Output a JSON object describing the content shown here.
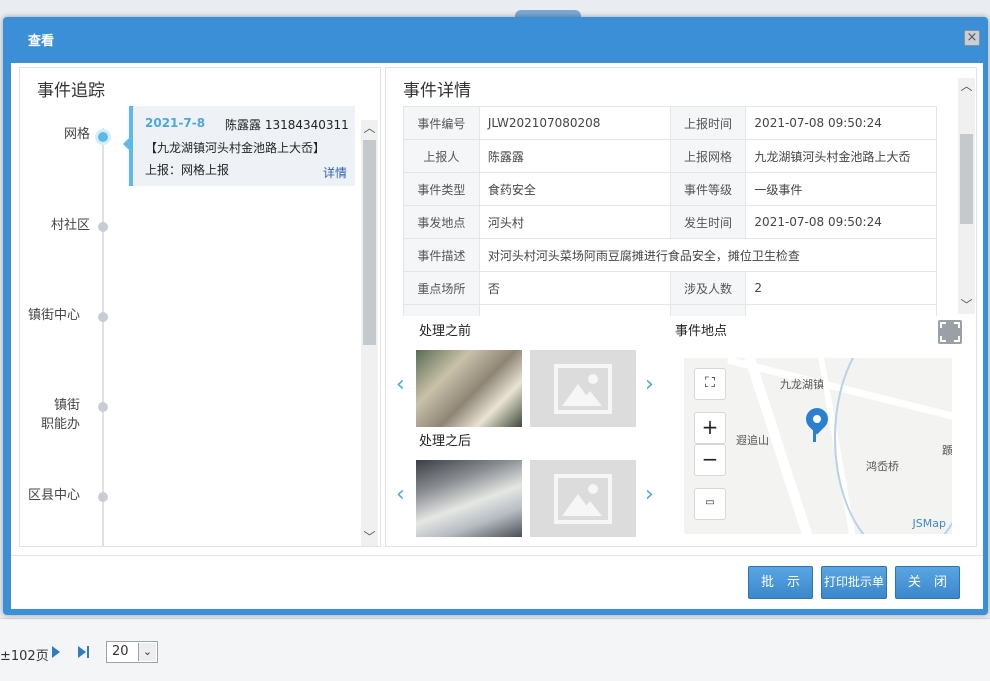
{
  "background": {
    "page_info": "±102页",
    "page_size": "20",
    "page_size_arrow": "⌄"
  },
  "modal": {
    "title": "查看",
    "close_glyph": "×",
    "left": {
      "title": "事件追踪",
      "timeline": [
        "网格",
        "村社区",
        "镇街中心",
        "镇街\n职能办",
        "区县中心"
      ],
      "event": {
        "date": "2021-7-8",
        "person": "陈露露 13184340311",
        "place": "【九龙湖镇河头村金池路上大岙】",
        "report": "上报：网格上报",
        "detail_link": "详情"
      }
    },
    "right": {
      "title": "事件详情",
      "rows": [
        [
          {
            "l": "事件编号",
            "v": "JLW202107080208"
          },
          {
            "l": "上报时间",
            "v": "2021-07-08 09:50:24"
          }
        ],
        [
          {
            "l": "上报人",
            "v": "陈露露"
          },
          {
            "l": "上报网格",
            "v": "九龙湖镇河头村金池路上大岙"
          }
        ],
        [
          {
            "l": "事件类型",
            "v": "食药安全"
          },
          {
            "l": "事件等级",
            "v": "一级事件"
          }
        ],
        [
          {
            "l": "事发地点",
            "v": "河头村"
          },
          {
            "l": "发生时间",
            "v": "2021-07-08 09:50:24"
          }
        ],
        [
          {
            "l": "事件描述",
            "v": "对河头村河头菜场阿雨豆腐摊进行食品安全，摊位卫生检查"
          }
        ],
        [
          {
            "l": "重点场所",
            "v": "否"
          },
          {
            "l": "涉及人数",
            "v": "2"
          }
        ]
      ],
      "before_label": "处理之前",
      "after_label": "处理之后",
      "location_label": "事件地点",
      "prev_glyph": "‹",
      "next_glyph": "›",
      "map": {
        "zoom_in": "+",
        "zoom_out": "−",
        "place_jiulonghu": "九龙湖镇",
        "place_xiazhuishan": "遐追山",
        "place_hongqiao": "鸿岙桥",
        "place_edge": "踬",
        "attribution": "JSMap"
      }
    },
    "buttons": {
      "approve": "批　示",
      "print": "打印批示单",
      "close": "关　闭"
    }
  }
}
